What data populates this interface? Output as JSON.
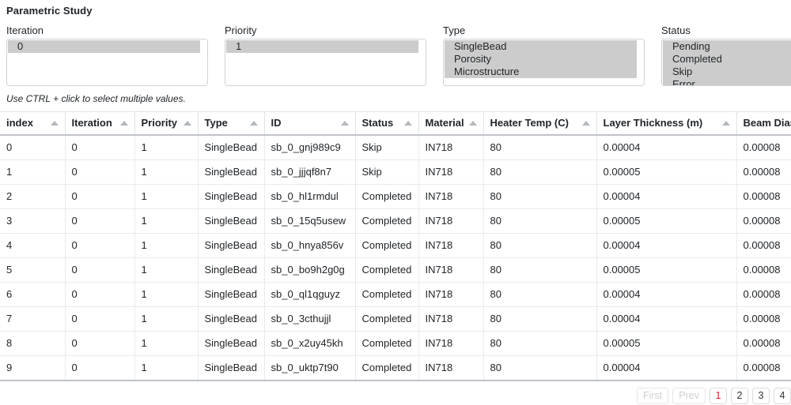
{
  "page_title": "Parametric Study",
  "hint": "Use CTRL + click to select multiple values.",
  "filters": [
    {
      "label": "Iteration",
      "name": "iteration",
      "options": [
        {
          "label": "0",
          "selected": true
        }
      ]
    },
    {
      "label": "Priority",
      "name": "priority",
      "options": [
        {
          "label": "1",
          "selected": true
        }
      ]
    },
    {
      "label": "Type",
      "name": "type",
      "options": [
        {
          "label": "SingleBead",
          "selected": true
        },
        {
          "label": "Porosity",
          "selected": true
        },
        {
          "label": "Microstructure",
          "selected": true
        }
      ]
    },
    {
      "label": "Status",
      "name": "status",
      "options": [
        {
          "label": "Pending",
          "selected": true
        },
        {
          "label": "Completed",
          "selected": true
        },
        {
          "label": "Skip",
          "selected": true
        },
        {
          "label": "Error",
          "selected": true
        }
      ]
    }
  ],
  "table": {
    "columns": [
      {
        "key": "index",
        "label": "index",
        "sortable": true
      },
      {
        "key": "iteration",
        "label": "Iteration",
        "sortable": true
      },
      {
        "key": "priority",
        "label": "Priority",
        "sortable": true
      },
      {
        "key": "type",
        "label": "Type",
        "sortable": true
      },
      {
        "key": "id",
        "label": "ID",
        "sortable": true
      },
      {
        "key": "status",
        "label": "Status",
        "sortable": true
      },
      {
        "key": "material",
        "label": "Material",
        "sortable": true
      },
      {
        "key": "heater_temp",
        "label": "Heater Temp (C)",
        "sortable": true
      },
      {
        "key": "layer_thickness",
        "label": "Layer Thickness (m)",
        "sortable": true
      },
      {
        "key": "beam_diameter",
        "label": "Beam Diameter (m)",
        "sortable": true
      }
    ],
    "rows": [
      {
        "index": "0",
        "iteration": "0",
        "priority": "1",
        "type": "SingleBead",
        "id": "sb_0_gnj989c9",
        "status": "Skip",
        "material": "IN718",
        "heater_temp": "80",
        "layer_thickness": "0.00004",
        "beam_diameter": "0.00008"
      },
      {
        "index": "1",
        "iteration": "0",
        "priority": "1",
        "type": "SingleBead",
        "id": "sb_0_jjjqf8n7",
        "status": "Skip",
        "material": "IN718",
        "heater_temp": "80",
        "layer_thickness": "0.00005",
        "beam_diameter": "0.00008"
      },
      {
        "index": "2",
        "iteration": "0",
        "priority": "1",
        "type": "SingleBead",
        "id": "sb_0_hl1rmdul",
        "status": "Completed",
        "material": "IN718",
        "heater_temp": "80",
        "layer_thickness": "0.00004",
        "beam_diameter": "0.00008"
      },
      {
        "index": "3",
        "iteration": "0",
        "priority": "1",
        "type": "SingleBead",
        "id": "sb_0_15q5usew",
        "status": "Completed",
        "material": "IN718",
        "heater_temp": "80",
        "layer_thickness": "0.00005",
        "beam_diameter": "0.00008"
      },
      {
        "index": "4",
        "iteration": "0",
        "priority": "1",
        "type": "SingleBead",
        "id": "sb_0_hnya856v",
        "status": "Completed",
        "material": "IN718",
        "heater_temp": "80",
        "layer_thickness": "0.00004",
        "beam_diameter": "0.00008"
      },
      {
        "index": "5",
        "iteration": "0",
        "priority": "1",
        "type": "SingleBead",
        "id": "sb_0_bo9h2g0g",
        "status": "Completed",
        "material": "IN718",
        "heater_temp": "80",
        "layer_thickness": "0.00005",
        "beam_diameter": "0.00008"
      },
      {
        "index": "6",
        "iteration": "0",
        "priority": "1",
        "type": "SingleBead",
        "id": "sb_0_ql1qguyz",
        "status": "Completed",
        "material": "IN718",
        "heater_temp": "80",
        "layer_thickness": "0.00004",
        "beam_diameter": "0.00008"
      },
      {
        "index": "7",
        "iteration": "0",
        "priority": "1",
        "type": "SingleBead",
        "id": "sb_0_3cthujjl",
        "status": "Completed",
        "material": "IN718",
        "heater_temp": "80",
        "layer_thickness": "0.00004",
        "beam_diameter": "0.00008"
      },
      {
        "index": "8",
        "iteration": "0",
        "priority": "1",
        "type": "SingleBead",
        "id": "sb_0_x2uy45kh",
        "status": "Completed",
        "material": "IN718",
        "heater_temp": "80",
        "layer_thickness": "0.00005",
        "beam_diameter": "0.00008"
      },
      {
        "index": "9",
        "iteration": "0",
        "priority": "1",
        "type": "SingleBead",
        "id": "sb_0_uktp7t90",
        "status": "Completed",
        "material": "IN718",
        "heater_temp": "80",
        "layer_thickness": "0.00004",
        "beam_diameter": "0.00008"
      }
    ]
  },
  "pagination": {
    "first_label": "First",
    "prev_label": "Prev",
    "first_disabled": true,
    "prev_disabled": true,
    "pages": [
      "1",
      "2",
      "3",
      "4"
    ],
    "active_page": "1"
  },
  "colors": {
    "active_page": "#d81c1c",
    "selected_option_bg": "#cccccc",
    "header_border": "#bfc4c9"
  }
}
